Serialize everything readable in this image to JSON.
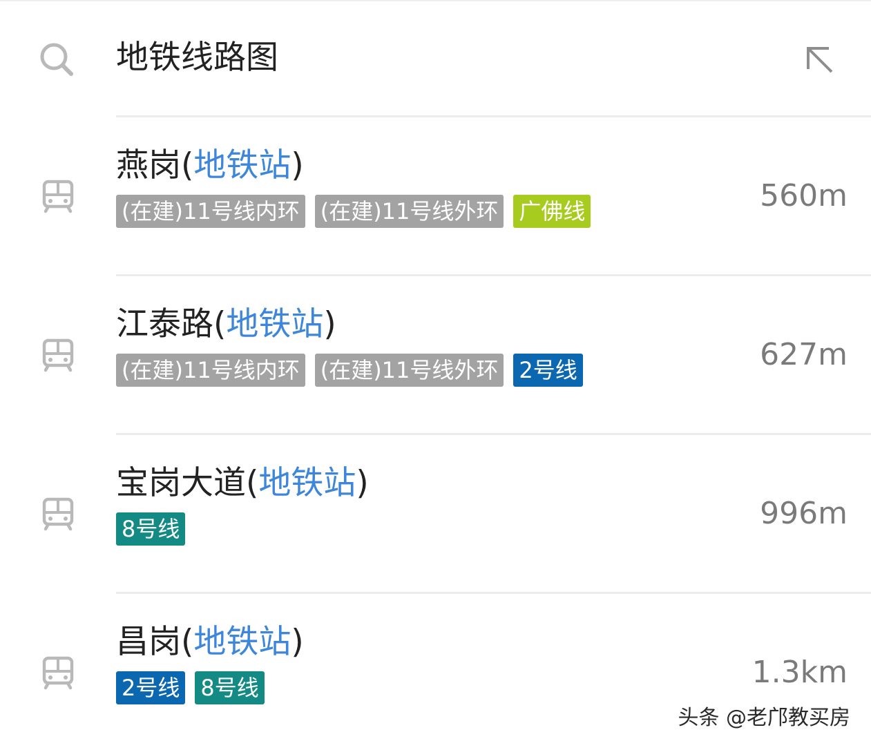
{
  "search": {
    "query": "地铁线路图",
    "search_icon": "search-icon",
    "fill_icon": "arrow-up-left-icon"
  },
  "colors": {
    "grey_tag": "#a3a3a3",
    "lime_tag": "#a7cc1f",
    "blue_tag": "#0b68b0",
    "teal_tag": "#138a84",
    "accent_text": "#3d86d9"
  },
  "results": [
    {
      "name": "燕岗",
      "open_paren": "(",
      "type": "地铁站",
      "close_paren": ")",
      "distance": "560m",
      "icon": "bus-icon",
      "lines": [
        {
          "label": "(在建)11号线内环",
          "color": "#a3a3a3"
        },
        {
          "label": "(在建)11号线外环",
          "color": "#a3a3a3"
        },
        {
          "label": "广佛线",
          "color": "#a7cc1f"
        }
      ]
    },
    {
      "name": "江泰路",
      "open_paren": "(",
      "type": "地铁站",
      "close_paren": ")",
      "distance": "627m",
      "icon": "bus-icon",
      "lines": [
        {
          "label": "(在建)11号线内环",
          "color": "#a3a3a3"
        },
        {
          "label": "(在建)11号线外环",
          "color": "#a3a3a3"
        },
        {
          "label": "2号线",
          "color": "#0b68b0"
        }
      ]
    },
    {
      "name": "宝岗大道",
      "open_paren": "(",
      "type": "地铁站",
      "close_paren": ")",
      "distance": "996m",
      "icon": "bus-icon",
      "lines": [
        {
          "label": "8号线",
          "color": "#138a84"
        }
      ]
    },
    {
      "name": "昌岗",
      "open_paren": "(",
      "type": "地铁站",
      "close_paren": ")",
      "distance": "1.3km",
      "icon": "bus-icon",
      "lines": [
        {
          "label": "2号线",
          "color": "#0b68b0"
        },
        {
          "label": "8号线",
          "color": "#138a84"
        }
      ]
    }
  ],
  "watermark": "头条 @老邝教买房"
}
